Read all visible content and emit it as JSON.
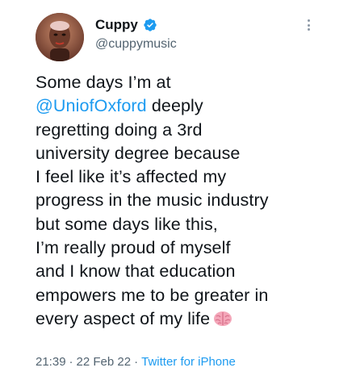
{
  "author": {
    "display_name": "Cuppy",
    "handle": "@cuppymusic",
    "verified": true,
    "avatar": "avatar-photo"
  },
  "tweet": {
    "lines": [
      {
        "text": "Some days I’m at"
      },
      {
        "mention": "@UniofOxford",
        "text": " deeply"
      },
      {
        "text": "regretting doing a 3rd"
      },
      {
        "text": "university degree because"
      },
      {
        "text": "I feel like it’s affected my"
      },
      {
        "text": "progress in the music industry"
      },
      {
        "text": "but some days like this,"
      },
      {
        "text": "I’m really proud of myself"
      },
      {
        "text": "and I know that education"
      },
      {
        "text": "empowers me to be greater in"
      },
      {
        "text": "every aspect of my life"
      }
    ],
    "emoji": "brain-icon"
  },
  "meta": {
    "time": "21:39",
    "separator": "·",
    "date": "22 Feb 22",
    "source": "Twitter for iPhone"
  },
  "icons": {
    "verified": "verified-badge-icon",
    "more": "more-options-icon"
  },
  "colors": {
    "link": "#1d9bf0",
    "secondary_text": "#536471",
    "primary_text": "#0f1419"
  }
}
